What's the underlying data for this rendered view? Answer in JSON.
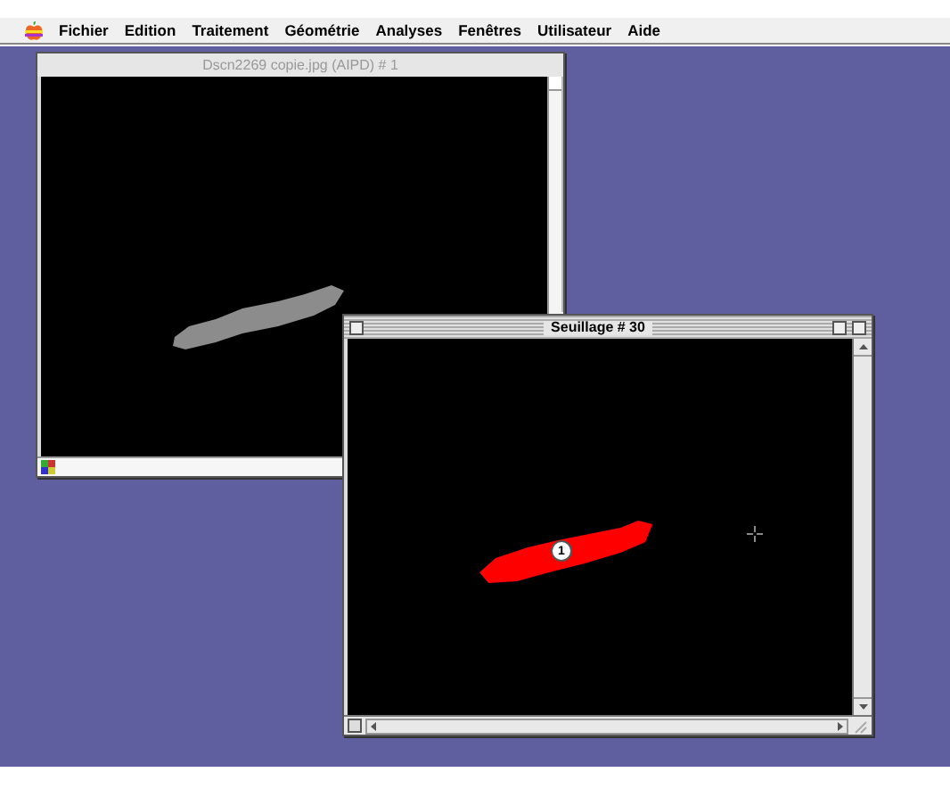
{
  "menu_bar": {
    "items": [
      {
        "label": "Fichier"
      },
      {
        "label": "Edition"
      },
      {
        "label": "Traitement"
      },
      {
        "label": "Géométrie"
      },
      {
        "label": "Analyses"
      },
      {
        "label": "Fenêtres"
      },
      {
        "label": "Utilisateur"
      },
      {
        "label": "Aide"
      }
    ]
  },
  "windows": [
    {
      "title": "Dscn2269 copie.jpg (AIPD) # 1",
      "active": false,
      "kind": "image"
    },
    {
      "title": "Seuillage # 30",
      "active": true,
      "kind": "threshold",
      "particle_label": "1"
    }
  ]
}
